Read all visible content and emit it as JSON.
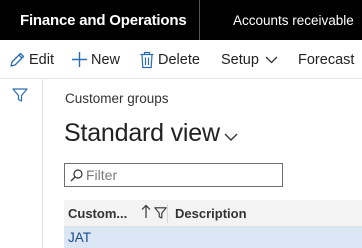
{
  "topbar": {
    "app_title": "Finance and Operations",
    "module": "Accounts receivable"
  },
  "actionbar": {
    "edit_label": "Edit",
    "new_label": "New",
    "delete_label": "Delete",
    "setup_label": "Setup",
    "forecast_label": "Forecast"
  },
  "page": {
    "breadcrumb": "Customer groups",
    "view_title": "Standard view"
  },
  "filter": {
    "placeholder": "Filter",
    "value": ""
  },
  "grid": {
    "columns": [
      "Custom...",
      "Description"
    ],
    "rows": [
      {
        "customer_group": "JAT",
        "description": ""
      }
    ]
  },
  "colors": {
    "topbar_bg": "#000000",
    "selected_row_bg": "#dbe6f4",
    "icon_accent": "#2b6cb0"
  }
}
